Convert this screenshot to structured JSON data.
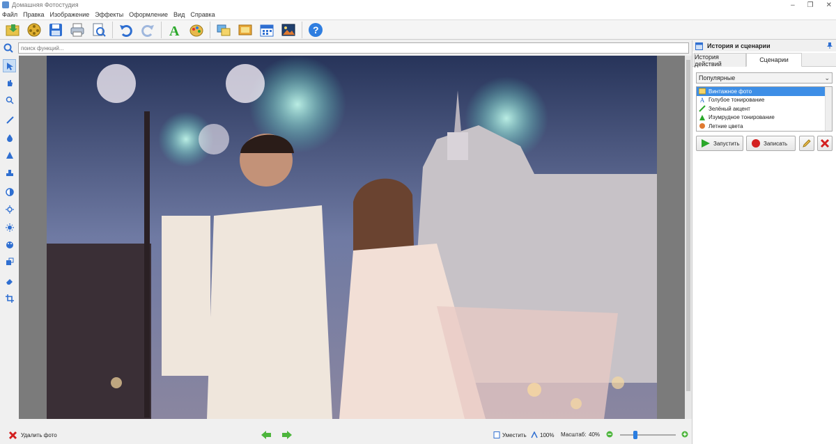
{
  "window": {
    "title": "Домашняя Фотостудия"
  },
  "menu": [
    "Файл",
    "Правка",
    "Изображение",
    "Эффекты",
    "Оформление",
    "Вид",
    "Справка"
  ],
  "search": {
    "placeholder": "поиск функций...",
    "value": ""
  },
  "panel": {
    "title": "История и сценарии",
    "tabs": [
      "История действий",
      "Сценарии"
    ],
    "active_tab": "Сценарии",
    "dropdown_value": "Популярные",
    "scenarios": [
      {
        "label": "Винтажное фото",
        "icon": "vintage-icon",
        "selected": true
      },
      {
        "label": "Голубое тонирование",
        "icon": "letter-a-icon",
        "selected": false
      },
      {
        "label": "Зелёный акцент",
        "icon": "brush-icon",
        "selected": false
      },
      {
        "label": "Изумрудное тонирование",
        "icon": "brush-icon",
        "selected": false
      },
      {
        "label": "Летние цвета",
        "icon": "palette-icon",
        "selected": false
      }
    ],
    "run_label": "Запустить",
    "record_label": "Записать"
  },
  "status": {
    "delete_label": "Удалить фото",
    "fit_label": "Уместить",
    "zoom_100": "100%",
    "scale_label": "Масштаб:",
    "scale_value": "40%",
    "zoom_level": 0.25
  },
  "colors": {
    "accent": "#3d8ee6",
    "selected_row": "#3d8ee6",
    "record_red": "#d32020",
    "run_green": "#2aa82a"
  }
}
